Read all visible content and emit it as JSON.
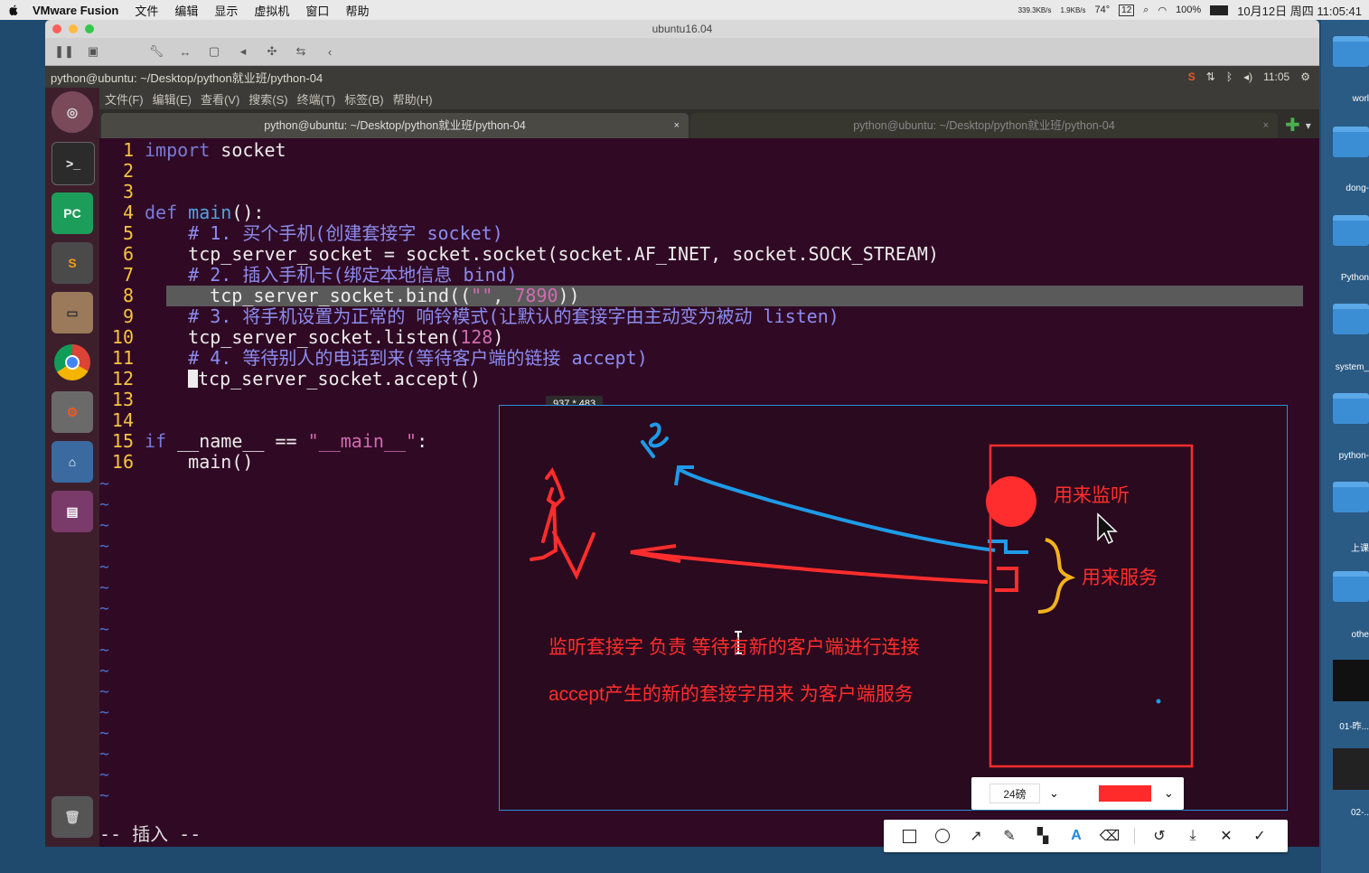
{
  "mac_menubar": {
    "app_name": "VMware Fusion",
    "menus": [
      "文件",
      "编辑",
      "显示",
      "虚拟机",
      "窗口",
      "帮助"
    ],
    "net_up": "339.3KB/s",
    "net_down": "1.9KB/s",
    "temperature": "74°",
    "calendar_day": "12",
    "battery": "100%",
    "clock": "10月12日 周四 11:05:41"
  },
  "vm_window": {
    "title": "ubuntu16.04"
  },
  "ubuntu": {
    "window_title": "python@ubuntu: ~/Desktop/python就业班/python-04",
    "time": "11:05"
  },
  "terminal": {
    "menus": [
      "文件(F)",
      "编辑(E)",
      "查看(V)",
      "搜索(S)",
      "终端(T)",
      "标签(B)",
      "帮助(H)"
    ],
    "tabs": [
      {
        "label": "python@ubuntu: ~/Desktop/python就业班/python-04",
        "close": "×"
      },
      {
        "label": "python@ubuntu: ~/Desktop/python就业班/python-04",
        "close": "×"
      }
    ]
  },
  "editor": {
    "line_numbers": [
      "1",
      "2",
      "3",
      "4",
      "5",
      "6",
      "7",
      "8",
      "9",
      "10",
      "11",
      "12",
      "13",
      "14",
      "15",
      "16"
    ],
    "lines": {
      "l1_kw": "import",
      "l1_rest": " socket",
      "l4_kw": "def",
      "l4_fn": "main",
      "l4_rest": "():",
      "l5": "    # 1. 买个手机(创建套接字 socket)",
      "l6": "    tcp_server_socket = socket.socket(socket.AF_INET, socket.SOCK_STREAM)",
      "l7": "    # 2. 插入手机卡(绑定本地信息 bind)",
      "l8_a": "    tcp_server_socket.bind((",
      "l8_str": "\"\"",
      "l8_b": ", ",
      "l8_num": "7890",
      "l8_c": "))",
      "l9": "    # 3. 将手机设置为正常的 响铃模式(让默认的套接字由主动变为被动 listen)",
      "l10_a": "    tcp_server_socket.listen(",
      "l10_num": "128",
      "l10_b": ")",
      "l11": "    # 4. 等待别人的电话到来(等待客户端的链接 accept)",
      "l12": "tcp_server_socket.accept()",
      "l15_kw": "if",
      "l15_a": " __name__ == ",
      "l15_str": "\"__main__\"",
      "l15_b": ":",
      "l16": "    main()"
    },
    "tilde": "~",
    "mode": "-- 插入 --"
  },
  "capture": {
    "size_label": "937 * 483",
    "label_listen": "用来监听",
    "label_serve": "用来服务",
    "note1": "监听套接字 负责 等待有新的客户端进行连接",
    "note2": "accept产生的新的套接字用来 为客户端服务",
    "font_size": "24磅",
    "accent": "#ff2d2d",
    "blue": "#1e9be8"
  },
  "desktop": {
    "labels": [
      "worl",
      "dong-",
      "Python",
      "system_",
      "python-",
      "上课",
      "othe",
      "01-昨...",
      "02-.."
    ]
  }
}
